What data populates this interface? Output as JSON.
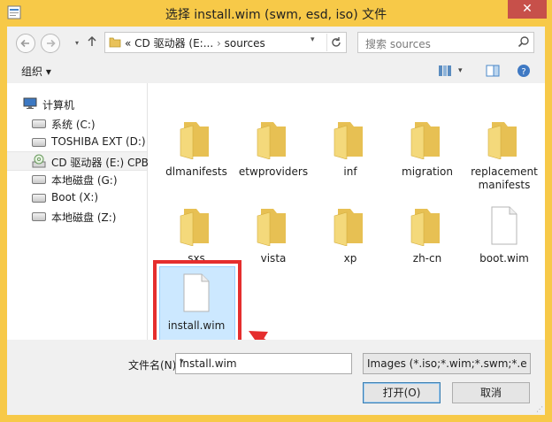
{
  "window": {
    "title": "选择 install.wim (swm, esd, iso) 文件",
    "close_glyph": "✕"
  },
  "address": {
    "overflow": "«",
    "crumbs": [
      "CD 驱动器 (E:...",
      "sources"
    ],
    "separator": "›"
  },
  "search": {
    "placeholder": "搜索 sources"
  },
  "toolbar": {
    "organize_label": "组织 ▾"
  },
  "navpane": {
    "root": "计算机",
    "items": [
      {
        "label": "系统 (C:)"
      },
      {
        "label": "TOSHIBA EXT (D:)"
      },
      {
        "label": "CD 驱动器 (E:) CPB"
      },
      {
        "label": "本地磁盘 (G:)"
      },
      {
        "label": "Boot (X:)"
      },
      {
        "label": "本地磁盘 (Z:)"
      }
    ]
  },
  "files": [
    {
      "name": "dlmanifests",
      "type": "folder"
    },
    {
      "name": "etwproviders",
      "type": "folder"
    },
    {
      "name": "inf",
      "type": "folder"
    },
    {
      "name": "migration",
      "type": "folder"
    },
    {
      "name": "replacementmanifests",
      "type": "folder"
    },
    {
      "name": "sxs",
      "type": "folder"
    },
    {
      "name": "vista",
      "type": "folder"
    },
    {
      "name": "xp",
      "type": "folder"
    },
    {
      "name": "zh-cn",
      "type": "folder"
    },
    {
      "name": "boot.wim",
      "type": "file"
    },
    {
      "name": "install.wim",
      "type": "file",
      "selected": true
    }
  ],
  "bottom": {
    "filename_label": "文件名(N):",
    "filename_value": "install.wim",
    "filter_value": "Images (*.iso;*.wim;*.swm;*.e",
    "open_label": "打开(O)",
    "cancel_label": "取消"
  },
  "colors": {
    "frame": "#f7c948",
    "highlight": "#e52e2e",
    "selection": "#cce8ff",
    "folder": "#f1cf5e"
  }
}
